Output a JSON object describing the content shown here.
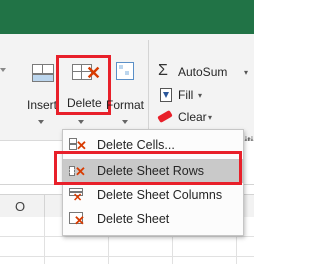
{
  "ribbon": {
    "insert_label": "Insert",
    "delete_label": "Delete",
    "format_label": "Format",
    "autosum_label": "AutoSum",
    "autosum_caret": "▾",
    "fill_label": "Fill",
    "fill_caret": "▾",
    "clear_label": "Clear",
    "clear_caret": "▾",
    "truncated_group_label": "diti",
    "sigma_glyph": "Σ"
  },
  "grid": {
    "column_letter": "O"
  },
  "delete_menu": {
    "items": [
      {
        "label": "Delete Cells...",
        "icon": "delete-cells-icon"
      },
      {
        "label": "Delete Sheet Rows",
        "icon": "delete-rows-icon"
      },
      {
        "label": "Delete Sheet Columns",
        "icon": "delete-columns-icon"
      },
      {
        "label": "Delete Sheet",
        "icon": "delete-sheet-icon"
      }
    ]
  },
  "colors": {
    "titlebar": "#217346",
    "highlight": "#e8202a",
    "accent_red": "#d83b01",
    "hover": "#c9c9c9"
  }
}
